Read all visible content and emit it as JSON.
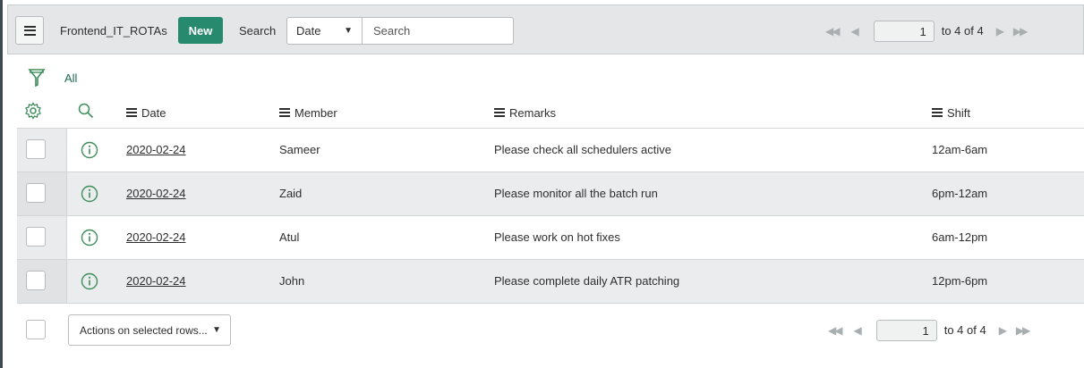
{
  "header": {
    "title": "Frontend_IT_ROTAs",
    "new_label": "New",
    "search_label": "Search",
    "search_field": "Date",
    "search_placeholder": "Search",
    "pager": {
      "current_page": "1",
      "range_text": "to 4 of 4"
    }
  },
  "filter": {
    "all_label": "All"
  },
  "columns": {
    "date": "Date",
    "member": "Member",
    "remarks": "Remarks",
    "shift": "Shift"
  },
  "rows": [
    {
      "date": "2020-02-24",
      "member": "Sameer",
      "remarks": "Please check all schedulers active",
      "shift": "12am-6am"
    },
    {
      "date": "2020-02-24",
      "member": "Zaid",
      "remarks": "Please monitor all the batch run",
      "shift": "6pm-12am"
    },
    {
      "date": "2020-02-24",
      "member": "Atul",
      "remarks": "Please work on hot fixes",
      "shift": "6am-12pm"
    },
    {
      "date": "2020-02-24",
      "member": "John",
      "remarks": "Please complete daily ATR patching",
      "shift": "12pm-6pm"
    }
  ],
  "footer": {
    "actions_label": "Actions on selected rows...",
    "pager": {
      "current_page": "1",
      "range_text": "to 4 of 4"
    }
  },
  "colors": {
    "accent": "#278a6e",
    "header_bg": "#e4e6e7",
    "alt_row": "#ebeced",
    "icon_green": "#3e8e5b"
  }
}
